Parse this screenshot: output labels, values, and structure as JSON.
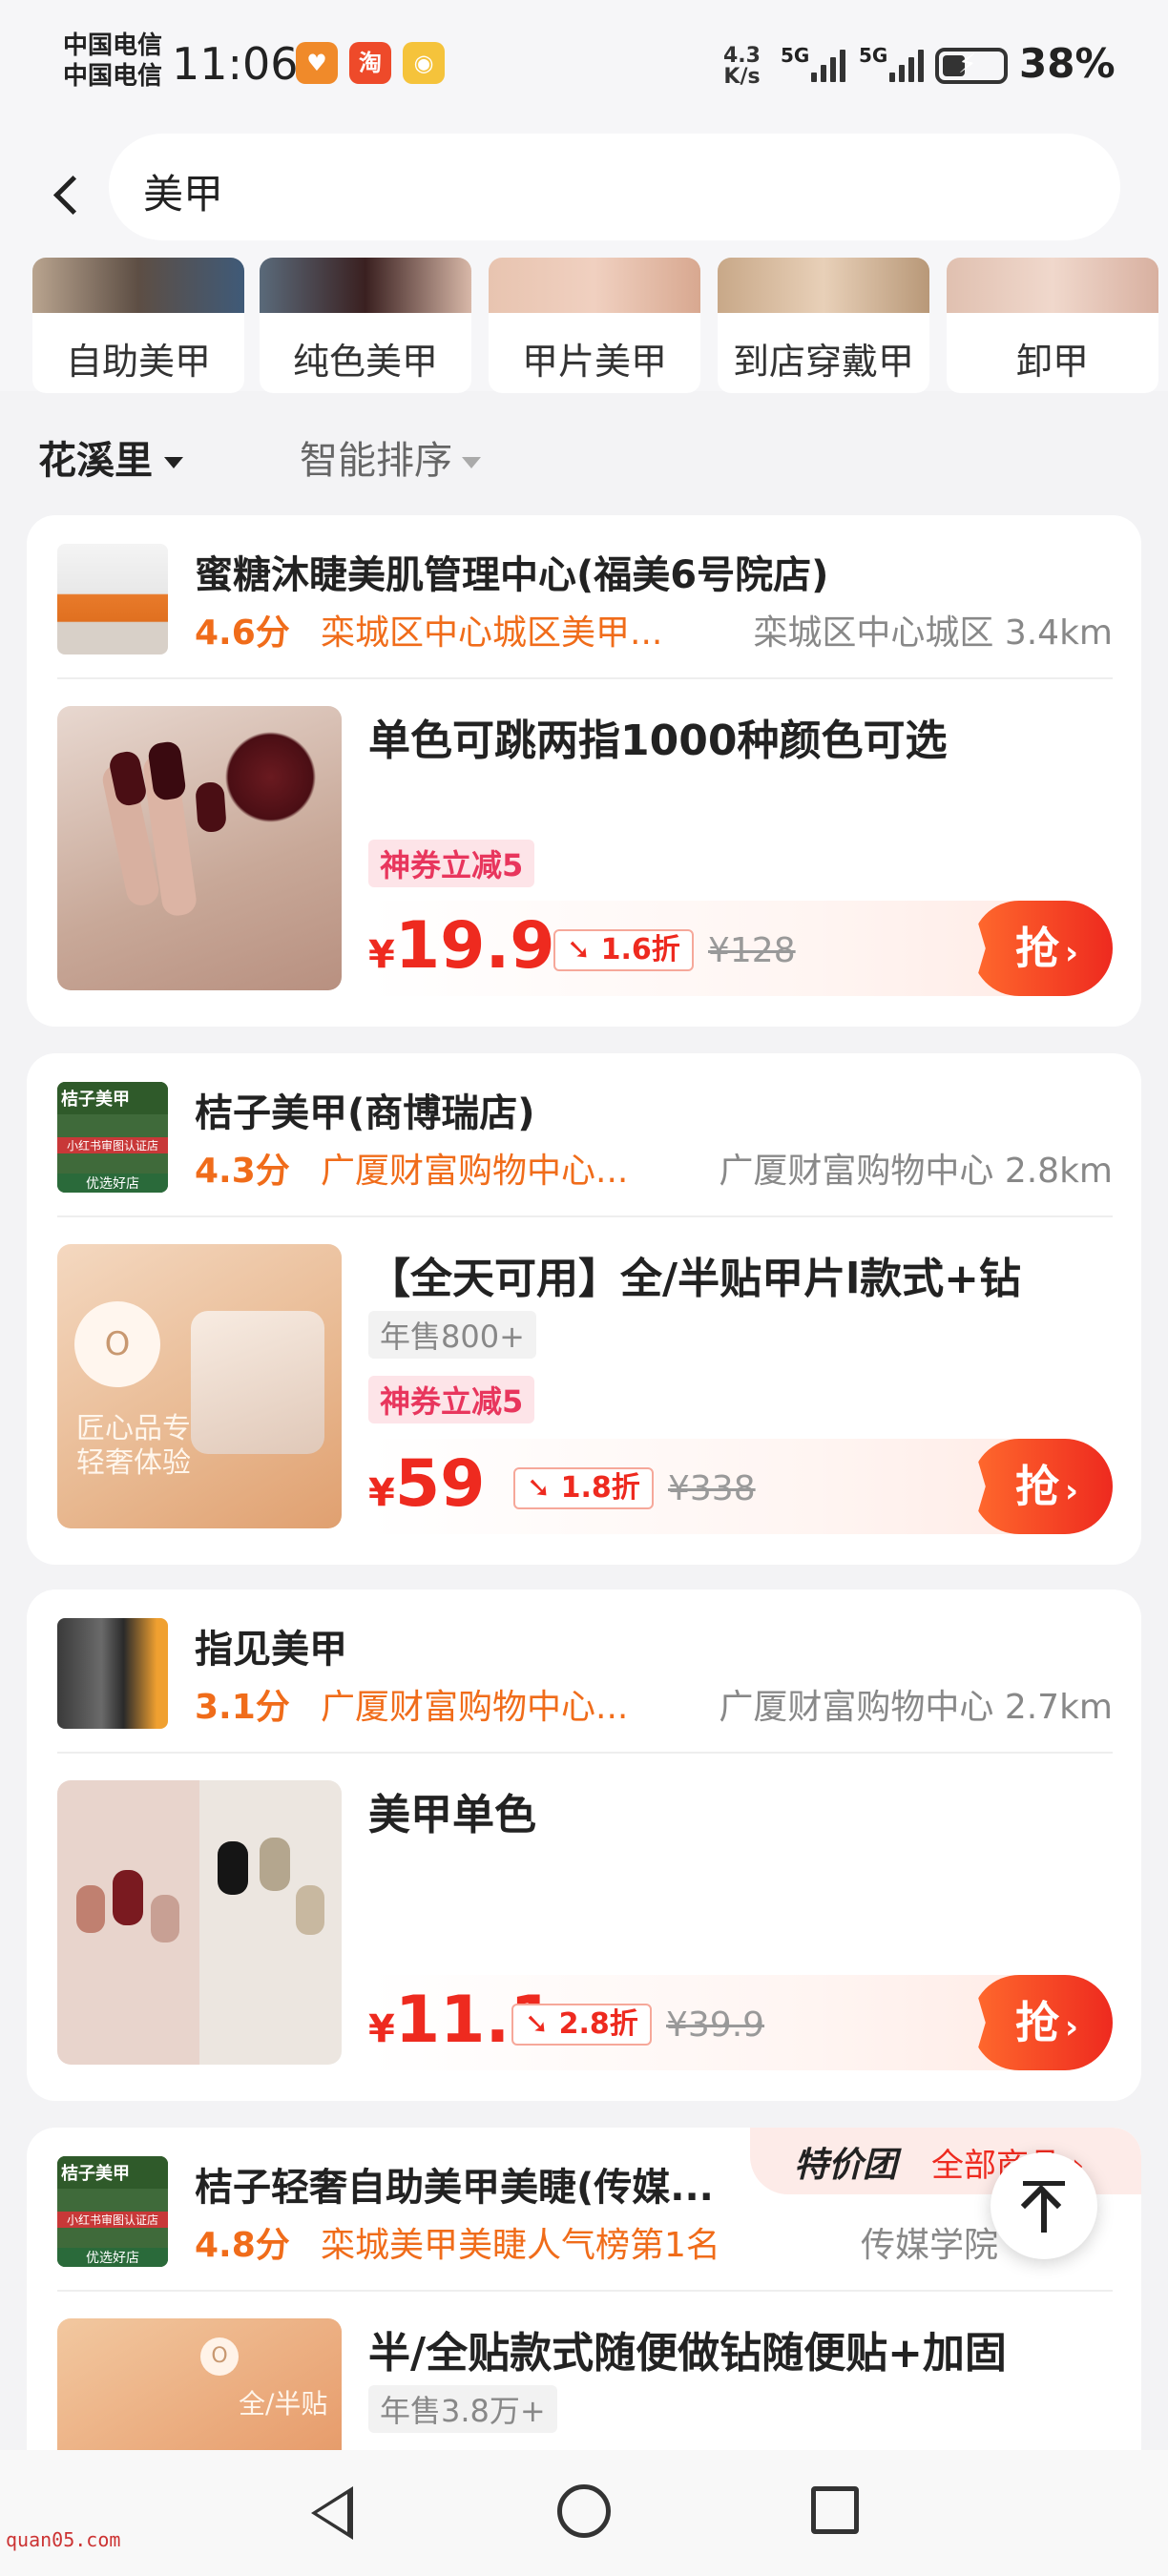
{
  "status": {
    "carrier1": "中国电信",
    "carrier2": "中国电信",
    "time": "11:06",
    "net_speed_value": "4.3",
    "net_speed_unit": "K/s",
    "signal1": "5G",
    "signal2": "5G",
    "battery_pct": "38%",
    "battery_level": 0.38
  },
  "search": {
    "query": "美甲"
  },
  "categories": [
    {
      "label": "自助美甲"
    },
    {
      "label": "纯色美甲"
    },
    {
      "label": "甲片美甲"
    },
    {
      "label": "到店穿戴甲"
    },
    {
      "label": "卸甲"
    }
  ],
  "filters": {
    "location": "花溪里",
    "sort": "智能排序"
  },
  "cards": [
    {
      "shop_name": "蜜糖沐睫美肌管理中心(福美6号院店)",
      "score": "4.6分",
      "tagline": "栾城区中心城区美甲...",
      "location": "栾城区中心城区 3.4km",
      "deal_title": "单色可跳两指1000种颜色可选",
      "coupon": "神券立减5",
      "price_cur": "¥",
      "price": "19.9",
      "discount": "1.6折",
      "orig": "¥128",
      "grab": "抢"
    },
    {
      "shop_name": "桔子美甲(商博瑞店)",
      "score": "4.3分",
      "tagline": "广厦财富购物中心...",
      "location": "广厦财富购物中心 2.8km",
      "deal_title": "【全天可用】全/半贴甲片l款式+钻",
      "sales": "年售800+",
      "coupon": "神券立减5",
      "price_cur": "¥",
      "price": "59",
      "discount": "1.8折",
      "orig": "¥338",
      "grab": "抢"
    },
    {
      "shop_name": "指见美甲",
      "score": "3.1分",
      "tagline": "广厦财富购物中心...",
      "location": "广厦财富购物中心 2.7km",
      "deal_title": "美甲单色",
      "price_cur": "¥",
      "price": "11.1",
      "discount": "2.8折",
      "orig": "¥39.9",
      "grab": "抢"
    },
    {
      "shop_name": "桔子轻奢自助美甲美睫(传媒...",
      "score": "4.8分",
      "tagline": "栾城美甲美睫人气榜第1名",
      "location": "传媒学院",
      "deal_title": "半/全贴款式随便做钻随便贴+加固",
      "sales": "年售3.8万+",
      "banner_logo": "特价团",
      "banner_all": "全部商品 ›"
    }
  ],
  "thumb_texts": {
    "orange_store_top": "桔子美甲",
    "orange_store_badge": "小红书审图认证店",
    "orange_store_bottom": "优选好店",
    "deal2_line1": "匠心品专",
    "deal2_line2": "轻奢体验",
    "deal4_label": "全/半贴"
  },
  "watermark": "quan05.com",
  "colors": {
    "accent": "#ee2a1f",
    "score": "#f06c1a",
    "coupon": "#e8365d"
  }
}
